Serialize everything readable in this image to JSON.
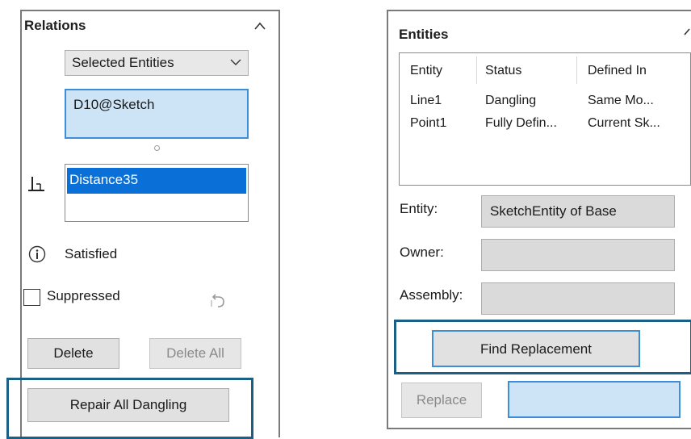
{
  "relations": {
    "title": "Relations",
    "dropdown_value": "Selected Entities",
    "entity_value": "D10@Sketch",
    "selected_relation": "Distance35",
    "status": "Satisfied",
    "suppressed_label": "Suppressed",
    "delete_label": "Delete",
    "delete_all_label": "Delete All",
    "repair_label": "Repair All Dangling"
  },
  "entities": {
    "title": "Entities",
    "columns": [
      "Entity",
      "Status",
      "Defined In"
    ],
    "rows": [
      [
        "Line1",
        "Dangling",
        "Same Mo..."
      ],
      [
        "Point1",
        "Fully Defin...",
        "Current Sk..."
      ]
    ],
    "entity_label": "Entity:",
    "entity_value": "SketchEntity of Base",
    "owner_label": "Owner:",
    "owner_value": "",
    "assembly_label": "Assembly:",
    "assembly_value": "",
    "find_replacement_label": "Find Replacement",
    "replace_label": "Replace",
    "replace_value": ""
  },
  "colors": {
    "selection_blue": "#0a6fd6",
    "field_blue": "#cde4f7",
    "highlight_frame": "#1b5f86"
  }
}
